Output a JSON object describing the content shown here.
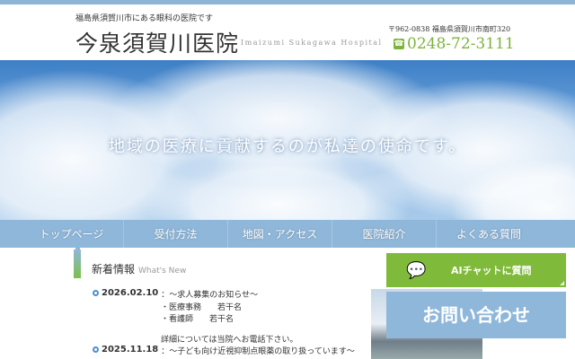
{
  "header": {
    "tagline": "福島県須賀川市にある眼科の医院です",
    "logo": "今泉須賀川医院",
    "logo_en": "Imaizumi Sukagawa Hospital",
    "address": "〒962-0838 福島県須賀川市南町320",
    "phone": "0248-72-3111"
  },
  "hero": {
    "message": "地域の医療に貢献するのが私達の使命です。"
  },
  "nav": [
    "トップページ",
    "受付方法",
    "地図・アクセス",
    "医院紹介",
    "よくある質問"
  ],
  "news": {
    "title": "新着情報",
    "subtitle": "What's New",
    "items": [
      {
        "date": "2026.02.10",
        "text": "：～求人募集のお知らせ～",
        "lines": [
          "・医療事務　　若干名",
          "・看護師　　若干名",
          "",
          "詳細については当院へお電話下さい。"
        ]
      },
      {
        "date": "2025.11.18",
        "text": "：～子ども向け近視抑制点眼薬の取り扱っています～"
      }
    ]
  },
  "side": {
    "ai_chat": "AIチャットに質問",
    "contact": "お問い合わせ"
  },
  "colors": {
    "green": "#7fba3a",
    "blue": "#8fb7da"
  }
}
